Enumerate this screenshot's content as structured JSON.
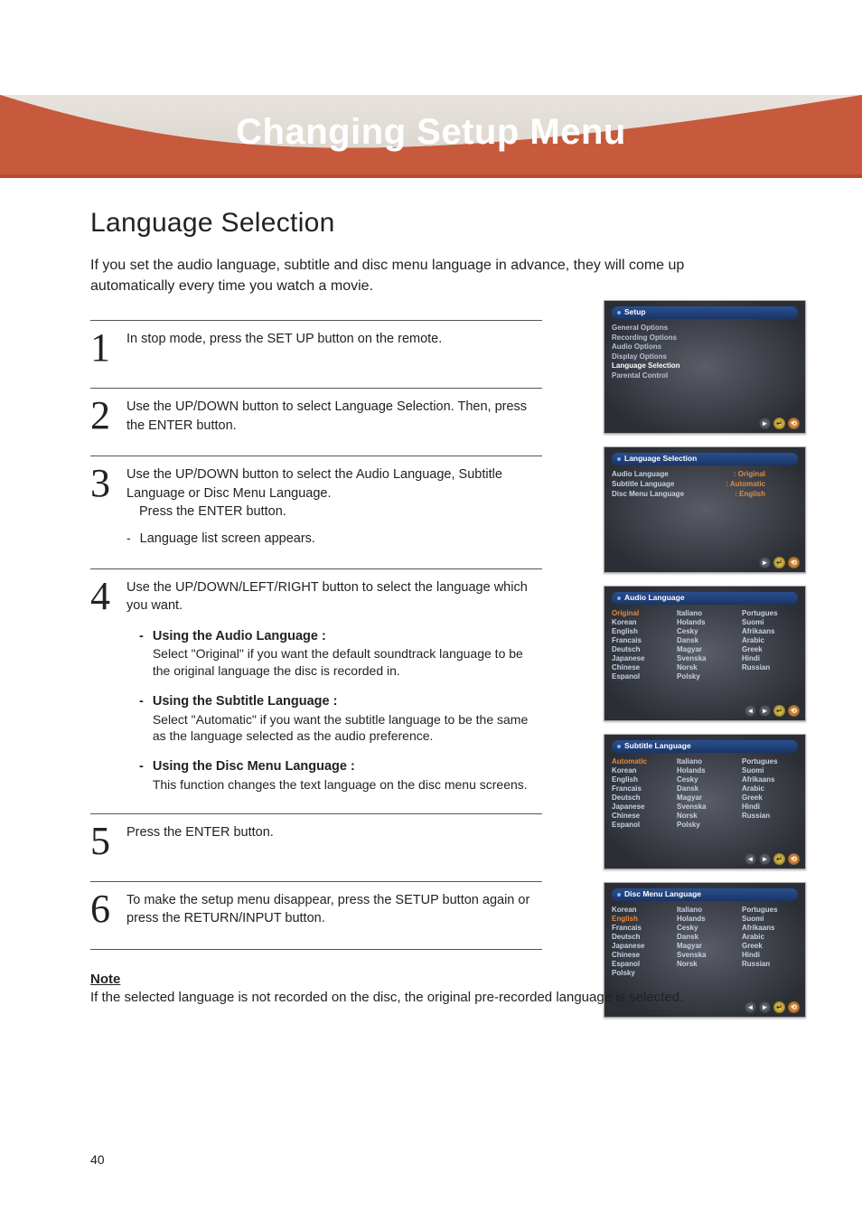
{
  "banner_title": "Changing Setup Menu",
  "h1": "Language Selection",
  "intro": "If you set the audio language, subtitle and disc menu language in advance, they will come up automatically every time you watch a movie.",
  "steps": {
    "s1": {
      "num": "1",
      "text": "In stop mode, press the SET UP button on the remote."
    },
    "s2": {
      "num": "2",
      "text": "Use the UP/DOWN button to select Language Selection. Then, press the ENTER button."
    },
    "s3": {
      "num": "3",
      "text": "Use the UP/DOWN button to select the Audio Language, Subtitle Language or Disc Menu Language.",
      "text2": "Press the ENTER button.",
      "dash": "-",
      "sub": "Language list screen appears."
    },
    "s4": {
      "num": "4",
      "text": "Use the UP/DOWN/LEFT/RIGHT button to select the language which you want.",
      "b1": {
        "d": "-",
        "head": "Using the Audio Language :",
        "body": "Select \"Original\" if you want the default soundtrack language to be the original language the disc is recorded in."
      },
      "b2": {
        "d": "-",
        "head": "Using the Subtitle Language :",
        "body": "Select \"Automatic\" if you want the subtitle language to be the same as the language selected as the audio preference."
      },
      "b3": {
        "d": "-",
        "head": "Using the Disc Menu Language :",
        "body": "This function changes the text language on the disc menu screens."
      }
    },
    "s5": {
      "num": "5",
      "text": "Press the ENTER button."
    },
    "s6": {
      "num": "6",
      "text": "To make the setup menu disappear, press the SETUP button again or press the RETURN/INPUT button."
    }
  },
  "note": {
    "head": "Note",
    "body": "If the selected language is not recorded on the disc, the original pre-recorded language is selected."
  },
  "page_number": "40",
  "shots": {
    "setup": {
      "title": "Setup",
      "items": [
        "General Options",
        "Recording Options",
        "Audio Options",
        "Display Options",
        "Language Selection",
        "Parental Control"
      ]
    },
    "langsel": {
      "title": "Language Selection",
      "rows": [
        {
          "k": "Audio Language",
          "v": ": Original"
        },
        {
          "k": "Subtitle Language",
          "v": ": Automatic"
        },
        {
          "k": "Disc Menu Language",
          "v": ": English"
        }
      ]
    },
    "audio": {
      "title": "Audio Language",
      "col1": [
        "Original",
        "Korean",
        "English",
        "Francais",
        "Deutsch",
        "Japanese",
        "Chinese",
        "Espanol"
      ],
      "col2": [
        "Italiano",
        "Holands",
        "Cesky",
        "Dansk",
        "Magyar",
        "Svenska",
        "Norsk",
        "Polsky"
      ],
      "col3": [
        "Portugues",
        "Suomi",
        "Afrikaans",
        "Arabic",
        "Greek",
        "Hindi",
        "Russian"
      ]
    },
    "subtitle": {
      "title": "Subtitle Language",
      "col1": [
        "Automatic",
        "Korean",
        "English",
        "Francais",
        "Deutsch",
        "Japanese",
        "Chinese",
        "Espanol"
      ],
      "col2": [
        "Italiano",
        "Holands",
        "Cesky",
        "Dansk",
        "Magyar",
        "Svenska",
        "Norsk",
        "Polsky"
      ],
      "col3": [
        "Portugues",
        "Suomi",
        "Afrikaans",
        "Arabic",
        "Greek",
        "Hindi",
        "Russian"
      ]
    },
    "discmenu": {
      "title": "Disc Menu Language",
      "col1": [
        "Korean",
        "English",
        "Francais",
        "Deutsch",
        "Japanese",
        "Chinese",
        "Espanol",
        "Polsky"
      ],
      "col2": [
        "Italiano",
        "Holands",
        "Cesky",
        "Dansk",
        "Magyar",
        "Svenska",
        "Norsk"
      ],
      "col3": [
        "Portugues",
        "Suomi",
        "Afrikaans",
        "Arabic",
        "Greek",
        "Hindi",
        "Russian"
      ]
    },
    "icons": {
      "left": "◄",
      "right": "►",
      "enter": "↵",
      "back": "⟲"
    }
  }
}
